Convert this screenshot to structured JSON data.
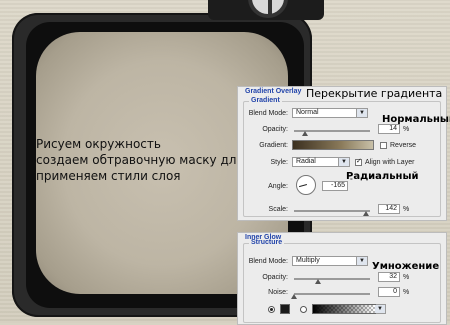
{
  "notes": {
    "line1": "Рисуем окружность",
    "line2": "создаем обтравочную маску для слоя",
    "line3": "применяем стили слоя"
  },
  "gradient_overlay": {
    "panel_title": "Gradient Overlay",
    "group_title": "Gradient",
    "annotation_title": "Перекрытие градиента",
    "blend_mode_label": "Blend Mode:",
    "blend_mode_value": "Normal",
    "blend_mode_annotation": "Нормальный",
    "opacity_label": "Opacity:",
    "opacity_value": "14",
    "opacity_fraction": 0.14,
    "opacity_unit": "%",
    "gradient_label": "Gradient:",
    "reverse_label": "Reverse",
    "reverse_checked": false,
    "style_label": "Style:",
    "style_value": "Radial",
    "style_annotation": "Радиальный",
    "align_label": "Align with Layer",
    "align_checked": true,
    "angle_label": "Angle:",
    "angle_value": "-165",
    "angle_unit": "°",
    "scale_label": "Scale:",
    "scale_value": "142",
    "scale_unit": "%",
    "scale_fraction": 0.95
  },
  "inner_glow": {
    "panel_title": "Inner Glow",
    "group_title": "Structure",
    "blend_mode_label": "Blend Mode:",
    "blend_mode_value": "Multiply",
    "blend_mode_annotation": "Умножение",
    "opacity_label": "Opacity:",
    "opacity_value": "32",
    "opacity_fraction": 0.32,
    "opacity_unit": "%",
    "noise_label": "Noise:",
    "noise_value": "0",
    "noise_unit": "%",
    "noise_fraction": 0.0,
    "color_mode": "solid"
  },
  "colors": {
    "screen": "#bdb5a4",
    "frame": "#2a2a2a",
    "panel_title": "#2244aa"
  }
}
